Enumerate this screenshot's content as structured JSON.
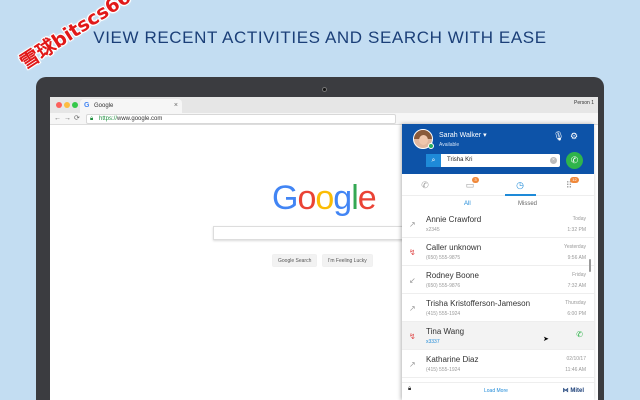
{
  "headline": "VIEW RECENT ACTIVITIES AND SEARCH WITH EASE",
  "watermark": "雪球bitscs66",
  "browser": {
    "tab_title": "Google",
    "tab_close": "×",
    "profile": "Person 1",
    "url_scheme": "https://",
    "url_host": "www.google.com",
    "back": "←",
    "forward": "→",
    "reload": "⟳"
  },
  "google": {
    "logo": [
      "G",
      "o",
      "o",
      "g",
      "l",
      "e"
    ],
    "logo_colors": [
      "#4285f4",
      "#ea4335",
      "#fbbc05",
      "#4285f4",
      "#34a853",
      "#ea4335"
    ],
    "search_button": "Google Search",
    "lucky_button": "I'm Feeling Lucky"
  },
  "panel": {
    "user_name": "Sarah Walker ▾",
    "user_status": "Available",
    "search_value": "Trisha Kri",
    "tabs": [
      {
        "icon": "phone-icon",
        "glyph": "✆"
      },
      {
        "icon": "chat-icon",
        "glyph": "▭",
        "badge": "3"
      },
      {
        "icon": "clock-icon",
        "glyph": "◷"
      },
      {
        "icon": "dialpad-icon",
        "glyph": "⠿",
        "badge": "12"
      }
    ],
    "subtab_all": "All",
    "subtab_missed": "Missed",
    "rows": [
      {
        "name": "Annie Crawford",
        "number": "x2345",
        "day": "Today",
        "time": "1:32 PM",
        "type": "outgoing"
      },
      {
        "name": "Caller unknown",
        "number": "(650) 555-9875",
        "day": "Yesterday",
        "time": "9:56 AM",
        "type": "missed"
      },
      {
        "name": "Rodney Boone",
        "number": "(650) 555-9876",
        "day": "Friday",
        "time": "7:32 AM",
        "type": "incoming"
      },
      {
        "name": "Trisha Kristofferson-Jameson",
        "number": "(415) 555-1924",
        "day": "Thursday",
        "time": "6:00 PM",
        "type": "outgoing"
      },
      {
        "name": "Tina Wang",
        "number": "x3337",
        "day": "",
        "time": "",
        "type": "missed"
      },
      {
        "name": "Katharine Diaz",
        "number": "(415) 555-1924",
        "day": "02/10/17",
        "time": "11:46 AM",
        "type": "outgoing"
      }
    ],
    "load_more": "Load More",
    "brand": "⋈ Mitel",
    "colors": {
      "header": "#0d53a8",
      "accent": "#1e8ad8",
      "call": "#2fb44b",
      "missed": "#e04848"
    }
  }
}
